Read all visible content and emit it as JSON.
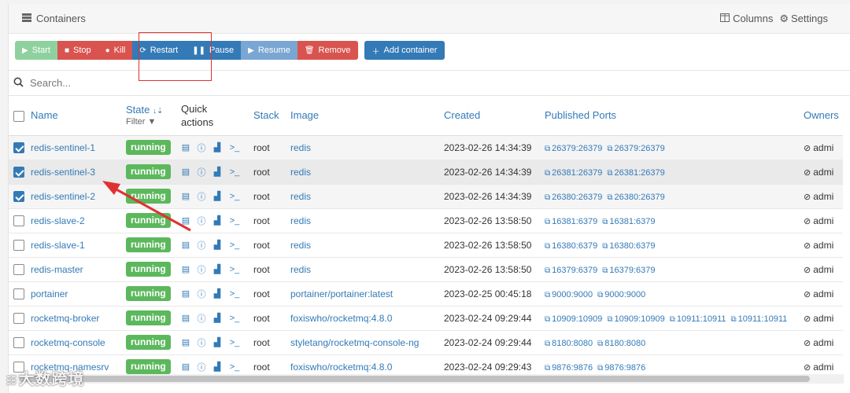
{
  "header": {
    "title": "Containers",
    "columns_label": "Columns",
    "settings_label": "Settings"
  },
  "toolbar": {
    "start": "Start",
    "stop": "Stop",
    "kill": "Kill",
    "restart": "Restart",
    "pause": "Pause",
    "resume": "Resume",
    "remove": "Remove",
    "add": "Add container"
  },
  "search": {
    "placeholder": "Search..."
  },
  "columns": {
    "name": "Name",
    "state": "State",
    "state_sort": "↓⇣",
    "filter": "Filter",
    "quick_actions_1": "Quick",
    "quick_actions_2": "actions",
    "stack": "Stack",
    "image": "Image",
    "created": "Created",
    "ports": "Published Ports",
    "owner": "Owners"
  },
  "rows": [
    {
      "name": "redis-sentinel-1",
      "checked": true,
      "state": "running",
      "stack": "root",
      "image": "redis",
      "created": "2023-02-26 14:34:39",
      "ports": [
        "26379:26379",
        "26379:26379"
      ],
      "owner": "admi"
    },
    {
      "name": "redis-sentinel-3",
      "checked": true,
      "state": "running",
      "stack": "root",
      "image": "redis",
      "created": "2023-02-26 14:34:39",
      "ports": [
        "26381:26379",
        "26381:26379"
      ],
      "owner": "admi"
    },
    {
      "name": "redis-sentinel-2",
      "checked": true,
      "state": "running",
      "stack": "root",
      "image": "redis",
      "created": "2023-02-26 14:34:39",
      "ports": [
        "26380:26379",
        "26380:26379"
      ],
      "owner": "admi"
    },
    {
      "name": "redis-slave-2",
      "checked": false,
      "state": "running",
      "stack": "root",
      "image": "redis",
      "created": "2023-02-26 13:58:50",
      "ports": [
        "16381:6379",
        "16381:6379"
      ],
      "owner": "admi"
    },
    {
      "name": "redis-slave-1",
      "checked": false,
      "state": "running",
      "stack": "root",
      "image": "redis",
      "created": "2023-02-26 13:58:50",
      "ports": [
        "16380:6379",
        "16380:6379"
      ],
      "owner": "admi"
    },
    {
      "name": "redis-master",
      "checked": false,
      "state": "running",
      "stack": "root",
      "image": "redis",
      "created": "2023-02-26 13:58:50",
      "ports": [
        "16379:6379",
        "16379:6379"
      ],
      "owner": "admi"
    },
    {
      "name": "portainer",
      "checked": false,
      "state": "running",
      "stack": "root",
      "image": "portainer/portainer:latest",
      "created": "2023-02-25 00:45:18",
      "ports": [
        "9000:9000",
        "9000:9000"
      ],
      "owner": "admi"
    },
    {
      "name": "rocketmq-broker",
      "checked": false,
      "state": "running",
      "stack": "root",
      "image": "foxiswho/rocketmq:4.8.0",
      "created": "2023-02-24 09:29:44",
      "ports": [
        "10909:10909",
        "10909:10909",
        "10911:10911",
        "10911:10911"
      ],
      "owner": "admi"
    },
    {
      "name": "rocketmq-console",
      "checked": false,
      "state": "running",
      "stack": "root",
      "image": "styletang/rocketmq-console-ng",
      "created": "2023-02-24 09:29:44",
      "ports": [
        "8180:8080",
        "8180:8080"
      ],
      "owner": "admi"
    },
    {
      "name": "rocketmq-namesrv",
      "checked": false,
      "state": "running",
      "stack": "root",
      "image": "foxiswho/rocketmq:4.8.0",
      "created": "2023-02-24 09:29:43",
      "ports": [
        "9876:9876",
        "9876:9876"
      ],
      "owner": "admi"
    }
  ],
  "watermark": "大数跨境",
  "colors": {
    "primary": "#337ab7",
    "danger": "#d9534f",
    "success": "#5cb85c",
    "annotation": "#e03131"
  },
  "icons": {
    "header": "server-icon",
    "columns": "columns-icon",
    "settings": "gear-icon",
    "search": "search-icon",
    "quick_actions": [
      "logs-icon",
      "info-icon",
      "stats-icon",
      "console-icon"
    ],
    "port": "external-link-icon",
    "owner": "eye-slash-icon"
  }
}
